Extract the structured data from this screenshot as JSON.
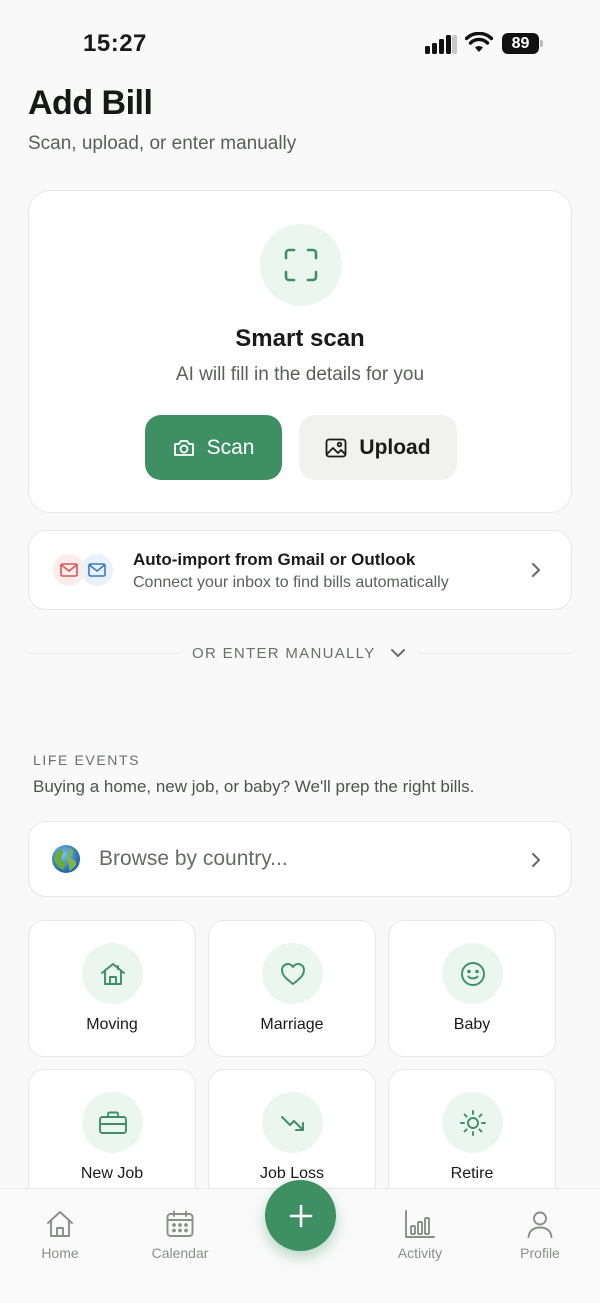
{
  "status_bar": {
    "time": "15:27",
    "battery": "89"
  },
  "header": {
    "title": "Add Bill",
    "subtitle": "Scan, upload, or enter manually"
  },
  "smart_scan": {
    "title": "Smart scan",
    "description": "AI will fill in the details for you",
    "scan_label": "Scan",
    "upload_label": "Upload"
  },
  "auto_import": {
    "title": "Auto-import from Gmail or Outlook",
    "description": "Connect your inbox to find bills automatically"
  },
  "divider": {
    "label": "OR ENTER MANUALLY"
  },
  "life_events": {
    "title": "LIFE EVENTS",
    "description": "Buying a home, new job, or baby? We'll prep the right bills.",
    "browse_label": "Browse by country...",
    "items": [
      {
        "label": "Moving",
        "icon": "home-icon"
      },
      {
        "label": "Marriage",
        "icon": "heart-icon"
      },
      {
        "label": "Baby",
        "icon": "smile-icon"
      },
      {
        "label": "New Job",
        "icon": "briefcase-icon"
      },
      {
        "label": "Job Loss",
        "icon": "trend-down-icon"
      },
      {
        "label": "Retire",
        "icon": "sun-icon"
      }
    ]
  },
  "bottom_nav": {
    "items": [
      {
        "label": "Home",
        "icon": "home-icon"
      },
      {
        "label": "Calendar",
        "icon": "calendar-icon"
      },
      {
        "label": "Activity",
        "icon": "bar-chart-icon"
      },
      {
        "label": "Profile",
        "icon": "person-icon"
      }
    ],
    "fab_icon": "plus-icon"
  },
  "colors": {
    "accent": "#3f8f65",
    "accent_soft": "#eaf6ef",
    "background": "#f9f9f9"
  }
}
